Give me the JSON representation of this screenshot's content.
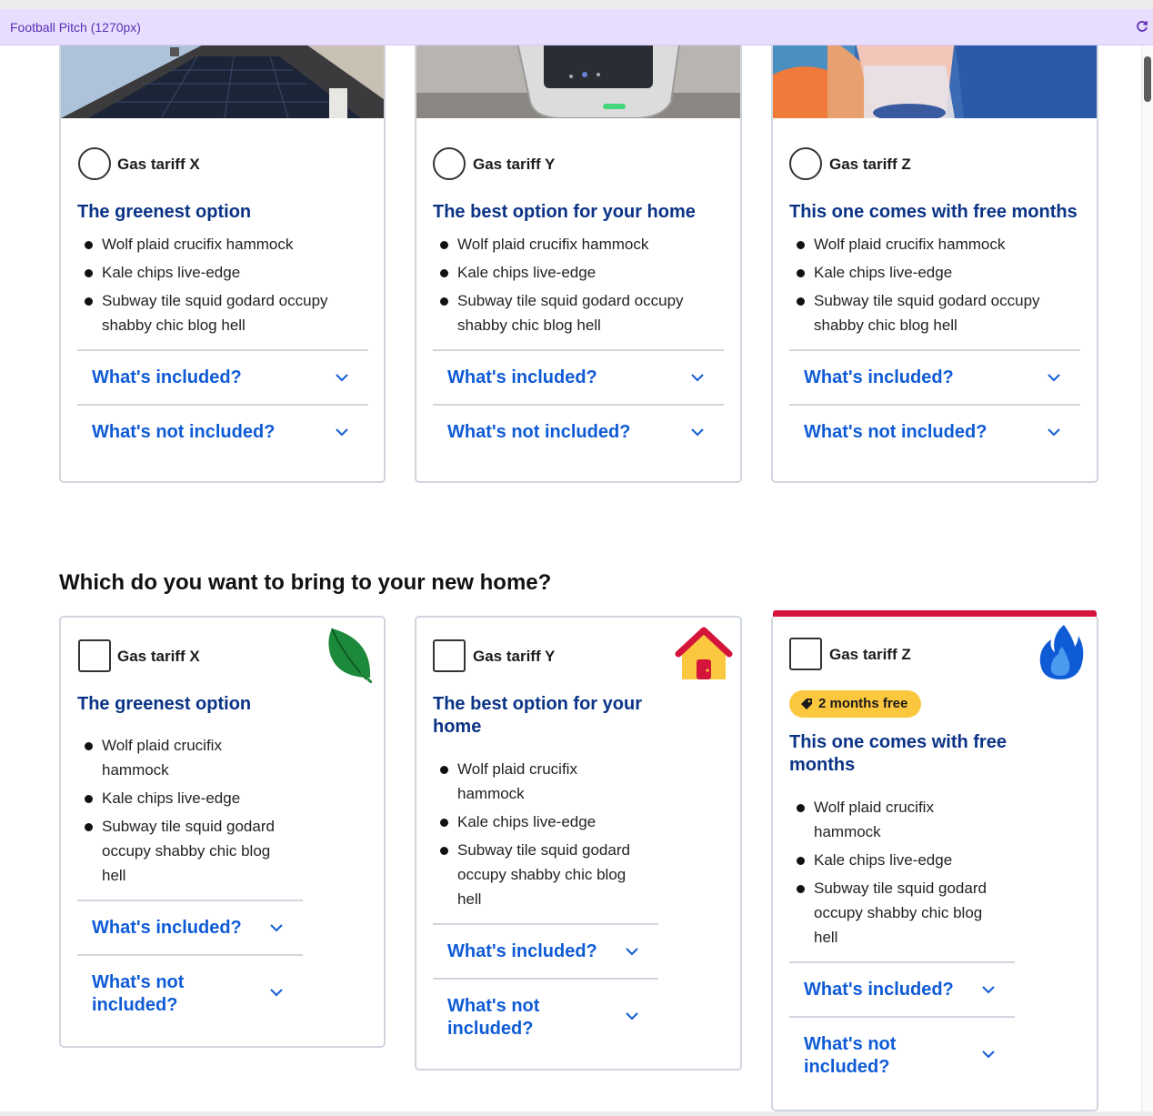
{
  "topbar": {
    "title": "Football Pitch (1270px)"
  },
  "section_top": {
    "cards": [
      {
        "option_label": "Gas tariff X",
        "heading": "The greenest option",
        "bullets": [
          "Wolf plaid crucifix hammock",
          "Kale chips live-edge",
          "Subway tile squid godard occupy shabby chic blog hell"
        ],
        "included_label": "What's included?",
        "not_included_label": "What's not included?"
      },
      {
        "option_label": "Gas tariff Y",
        "heading": "The best option for your home",
        "bullets": [
          "Wolf plaid crucifix hammock",
          "Kale chips live-edge",
          "Subway tile squid godard occupy shabby chic blog hell"
        ],
        "included_label": "What's included?",
        "not_included_label": "What's not included?"
      },
      {
        "option_label": "Gas tariff Z",
        "heading": "This one comes with free months",
        "bullets": [
          "Wolf plaid crucifix hammock",
          "Kale chips live-edge",
          "Subway tile squid godard occupy shabby chic blog hell"
        ],
        "included_label": "What's included?",
        "not_included_label": "What's not included?"
      }
    ]
  },
  "section_bottom": {
    "title": "Which do you want to bring to your new home?",
    "cards": [
      {
        "option_label": "Gas tariff X",
        "icon": "leaf-icon",
        "heading": "The greenest option",
        "bullets": [
          "Wolf plaid crucifix hammock",
          "Kale chips live-edge",
          "Subway tile squid godard occupy shabby chic blog hell"
        ],
        "included_label": "What's included?",
        "not_included_label": "What's not included?"
      },
      {
        "option_label": "Gas tariff Y",
        "icon": "house-icon",
        "heading": "The best option for your home",
        "bullets": [
          "Wolf plaid crucifix hammock",
          "Kale chips live-edge",
          "Subway tile squid godard occupy shabby chic blog hell"
        ],
        "included_label": "What's included?",
        "not_included_label": "What's not included?"
      },
      {
        "option_label": "Gas tariff Z",
        "icon": "flame-icon",
        "badge": "2 months free",
        "heading": "This one comes with free months",
        "bullets": [
          "Wolf plaid crucifix hammock",
          "Kale chips live-edge",
          "Subway tile squid godard occupy shabby chic blog hell"
        ],
        "included_label": "What's included?",
        "not_included_label": "What's not included?"
      }
    ]
  },
  "colors": {
    "heading_blue": "#0a3386",
    "link_blue": "#0f5bd6",
    "highlight_red": "#d5143c",
    "badge_yellow": "#fbc73f",
    "topbar_purple": "#e7ddfd"
  }
}
